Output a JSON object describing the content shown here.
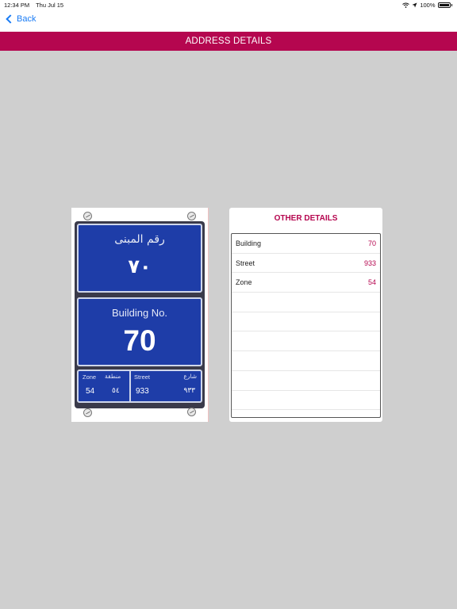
{
  "status_bar": {
    "time": "12:34 PM",
    "date": "Thu Jul 15",
    "battery": "100%"
  },
  "nav": {
    "back_label": "Back"
  },
  "title": "ADDRESS DETAILS",
  "sign": {
    "arabic_label": "رقم المبنى",
    "arabic_number": "٧٠",
    "english_label": "Building No.",
    "english_number": "70",
    "zone_label": "Zone",
    "zone_label_ar": "منطقة",
    "zone_value": "54",
    "zone_value_ar": "٥٤",
    "street_label": "Street",
    "street_label_ar": "شارع",
    "street_value": "933",
    "street_value_ar": "٩٣٣"
  },
  "details": {
    "title": "OTHER DETAILS",
    "rows": [
      {
        "label": "Building",
        "value": "70"
      },
      {
        "label": "Street",
        "value": "933"
      },
      {
        "label": "Zone",
        "value": "54"
      }
    ]
  },
  "colors": {
    "brand": "#b5064f",
    "link": "#1a7cf5",
    "sign_blue": "#1e3da8",
    "background": "#cfcfcf"
  },
  "icons": [
    "back-chevron-icon",
    "wifi-icon",
    "location-arrow-icon",
    "battery-icon",
    "screw-icon"
  ]
}
